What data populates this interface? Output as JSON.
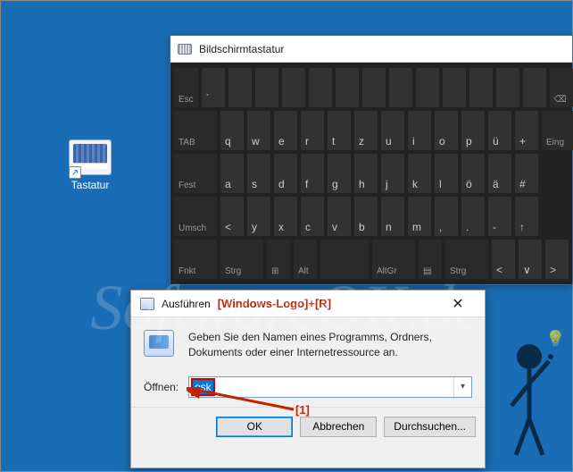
{
  "desktop_icon": {
    "label": "Tastatur"
  },
  "osk": {
    "title": "Bildschirmtastatur",
    "rows": [
      [
        "Esc",
        "`",
        "",
        "",
        "",
        "",
        "",
        "",
        "",
        "",
        "",
        "",
        "",
        "",
        "⌫"
      ],
      [
        "TAB",
        "q",
        "w",
        "e",
        "r",
        "t",
        "z",
        "u",
        "i",
        "o",
        "p",
        "ü",
        "+",
        "Eing"
      ],
      [
        "Fest",
        "a",
        "s",
        "d",
        "f",
        "g",
        "h",
        "j",
        "k",
        "l",
        "ö",
        "ä",
        "#"
      ],
      [
        "Umsch",
        "<",
        "y",
        "x",
        "c",
        "v",
        "b",
        "n",
        "m",
        ",",
        ".",
        "-",
        "↑"
      ],
      [
        "Fnkt",
        "Strg",
        "⊞",
        "Alt",
        "",
        "AltGr",
        "▤",
        "Strg",
        "<",
        "∨",
        ">"
      ]
    ]
  },
  "run": {
    "title": "Ausführen",
    "shortcut_annotation": "[Windows-Logo]+[R]",
    "description": "Geben Sie den Namen eines Programms, Ordners, Dokuments oder einer Internetressource an.",
    "open_label": "Öffnen:",
    "input_value": "osk",
    "buttons": {
      "ok": "OK",
      "cancel": "Abbrechen",
      "browse": "Durchsuchen..."
    }
  },
  "annotation": {
    "marker": "[1]"
  },
  "watermark": "SoftwareOK.de"
}
